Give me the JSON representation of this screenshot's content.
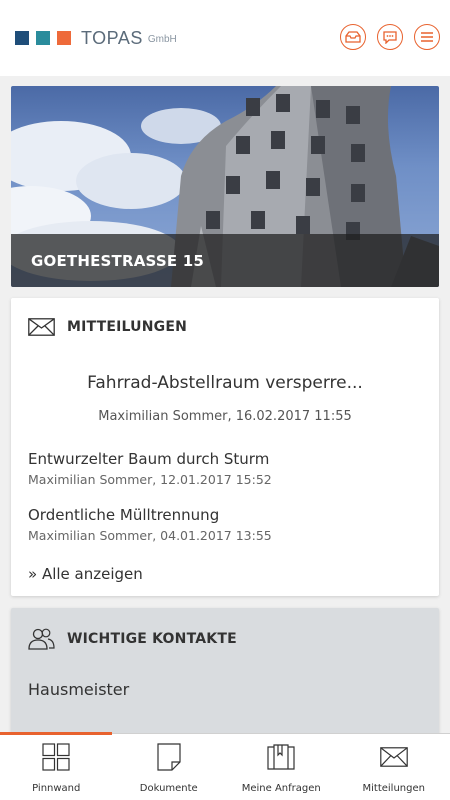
{
  "brand": {
    "name": "TOPAS",
    "suffix": "GmbH",
    "colors": [
      "#1f4e79",
      "#2a8c9c",
      "#ee6a3a"
    ]
  },
  "header_icons": [
    "inbox-icon",
    "chat-icon",
    "menu-icon"
  ],
  "accent_color": "#e8622e",
  "hero": {
    "title": "GOETHESTRASSE 15"
  },
  "messages_card": {
    "title": "MITTEILUNGEN",
    "icon": "envelope-icon",
    "featured": {
      "title": "Fahrrad-Abstellraum versperre...",
      "meta": "Maximilian Sommer, 16.02.2017 11:55"
    },
    "items": [
      {
        "title": "Entwurzelter Baum durch Sturm",
        "meta": "Maximilian Sommer, 12.01.2017 15:52"
      },
      {
        "title": "Ordentliche Mülltrennung",
        "meta": "Maximilian Sommer, 04.01.2017 13:55"
      }
    ],
    "show_all": "» Alle anzeigen"
  },
  "contacts_card": {
    "title": "WICHTIGE KONTAKTE",
    "icon": "people-icon",
    "items": [
      "Hausmeister"
    ]
  },
  "bottom_nav": {
    "active_index": 0,
    "items": [
      {
        "label": "Pinnwand",
        "icon": "grid-icon"
      },
      {
        "label": "Dokumente",
        "icon": "document-icon"
      },
      {
        "label": "Meine Anfragen",
        "icon": "requests-icon"
      },
      {
        "label": "Mitteilungen",
        "icon": "envelope-icon"
      }
    ]
  }
}
